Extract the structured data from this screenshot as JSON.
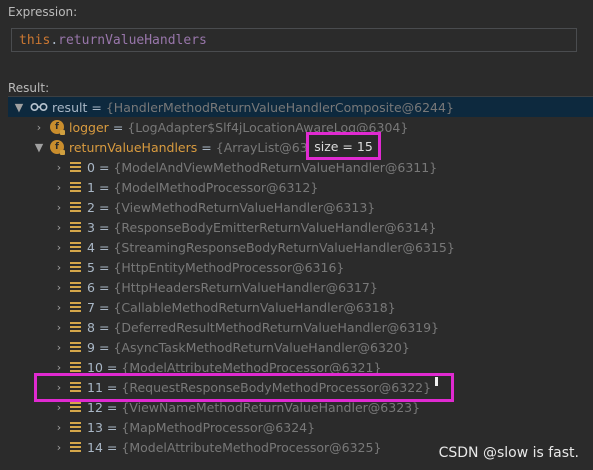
{
  "expression": {
    "label": "Expression:",
    "keyword": "this",
    "dot": ".",
    "field": "returnValueHandlers"
  },
  "result": {
    "label": "Result:",
    "root": {
      "name": "result",
      "value": "{HandlerMethodReturnValueHandlerComposite@6244}"
    },
    "logger": {
      "name": "logger",
      "value": "{LogAdapter$Slf4jLocationAwareLog@6304}"
    },
    "handlers": {
      "name": "returnValueHandlers",
      "value": "{ArrayList@6305}",
      "size_label": "size = 15"
    },
    "items": [
      {
        "index": "0",
        "value": "{ModelAndViewMethodReturnValueHandler@6311}"
      },
      {
        "index": "1",
        "value": "{ModelMethodProcessor@6312}"
      },
      {
        "index": "2",
        "value": "{ViewMethodReturnValueHandler@6313}"
      },
      {
        "index": "3",
        "value": "{ResponseBodyEmitterReturnValueHandler@6314}"
      },
      {
        "index": "4",
        "value": "{StreamingResponseBodyReturnValueHandler@6315}"
      },
      {
        "index": "5",
        "value": "{HttpEntityMethodProcessor@6316}"
      },
      {
        "index": "6",
        "value": "{HttpHeadersReturnValueHandler@6317}"
      },
      {
        "index": "7",
        "value": "{CallableMethodReturnValueHandler@6318}"
      },
      {
        "index": "8",
        "value": "{DeferredResultMethodReturnValueHandler@6319}"
      },
      {
        "index": "9",
        "value": "{AsyncTaskMethodReturnValueHandler@6320}"
      },
      {
        "index": "10",
        "value": "{ModelAttributeMethodProcessor@6321}"
      },
      {
        "index": "11",
        "value": "{RequestResponseBodyMethodProcessor@6322}"
      },
      {
        "index": "12",
        "value": "{ViewNameMethodReturnValueHandler@6323}"
      },
      {
        "index": "13",
        "value": "{MapMethodProcessor@6324}"
      },
      {
        "index": "14",
        "value": "{ModelAttributeMethodProcessor@6325}"
      }
    ]
  },
  "watermark": "CSDN @slow is fast.",
  "colors": {
    "background": "#2b2b2b",
    "highlight": "#e02ad1",
    "keyword": "#cc7832",
    "field": "#9876aa",
    "selected_row": "#0d293e"
  },
  "icons": {
    "expand_arrow": "chevron-right-icon",
    "collapse_arrow": "chevron-down-icon",
    "watch": "glasses-icon",
    "field": "field-icon",
    "list_item": "list-item-icon"
  }
}
